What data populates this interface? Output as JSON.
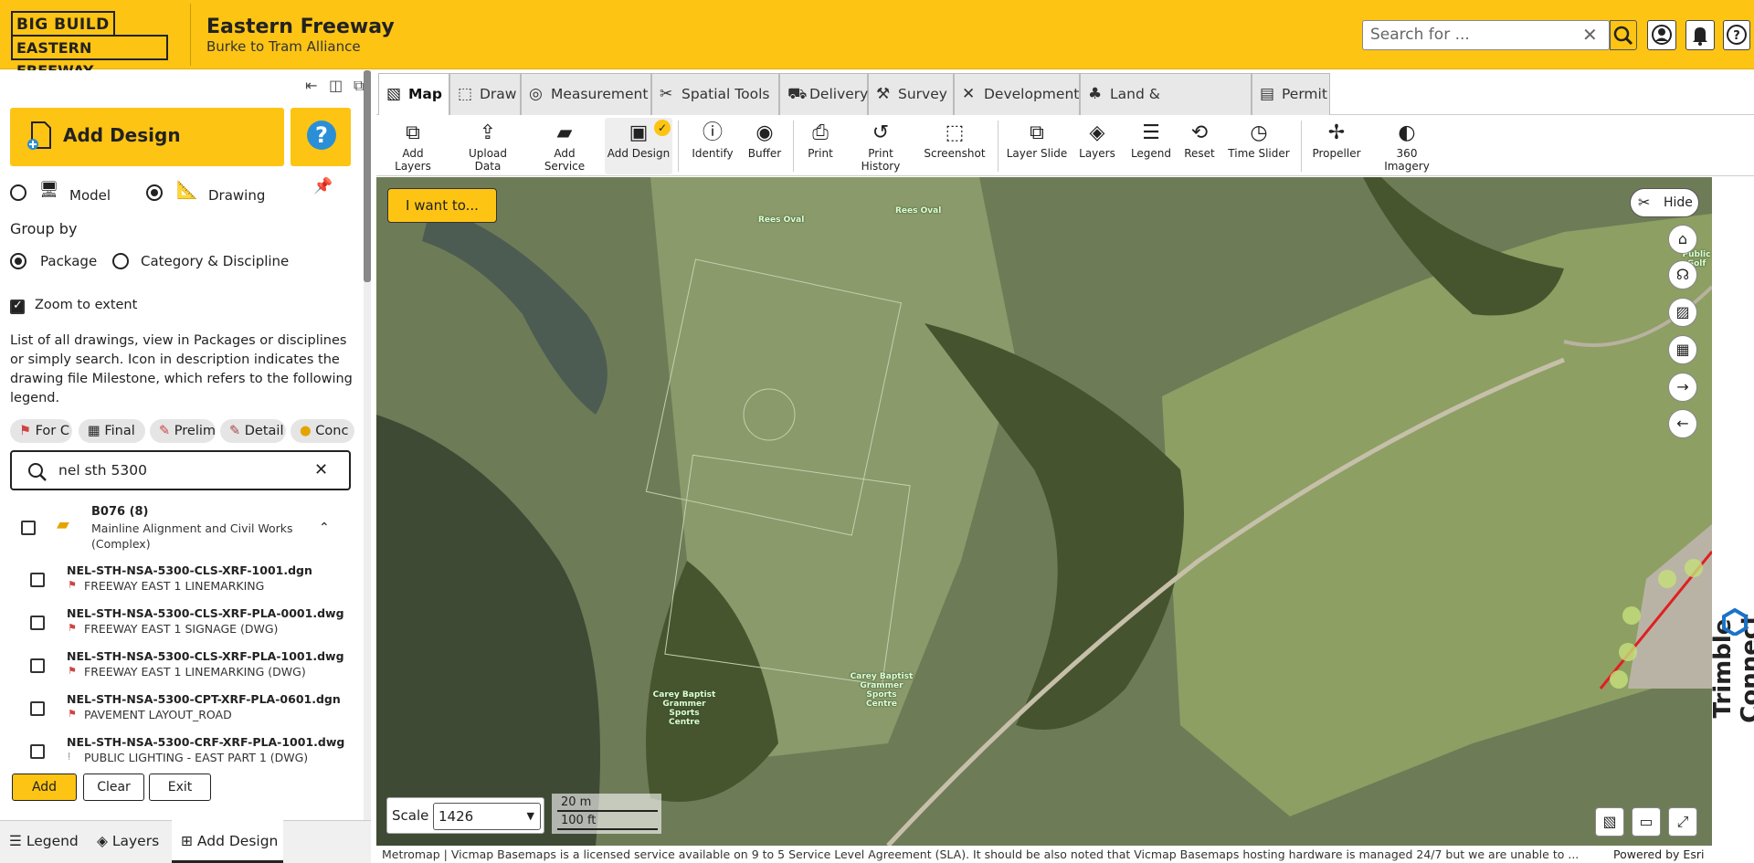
{
  "header": {
    "logo_line1": "BIG BUILD",
    "logo_line2": "EASTERN FREEWAY",
    "title": "Eastern Freeway",
    "subtitle": "Burke to Tram  Alliance",
    "search_placeholder": "Search for ...",
    "icons": [
      "search-icon",
      "user-icon",
      "bell-icon",
      "help-icon"
    ]
  },
  "panel": {
    "add_design_label": "Add Design",
    "model_label": "Model",
    "drawing_label": "Drawing",
    "group_by_label": "Group by",
    "package_label": "Package",
    "category_label": "Category & Discipline",
    "zoom_label": "Zoom to extent",
    "description": "List of all drawings, view in Packages or disciplines or simply search. Icon in description indicates the drawing file Milestone, which refers to the following legend.",
    "chips": [
      "For C",
      "Final",
      "Prelim",
      "Detail",
      "Conc"
    ],
    "filter_value": "nel sth 5300",
    "group": {
      "title": "B076 (8)",
      "subtitle": "Mainline Alignment and Civil Works (Complex)"
    },
    "files": [
      {
        "name": "NEL-STH-NSA-5300-CLS-XRF-1001.dgn",
        "desc": "FREEWAY EAST 1 LINEMARKING"
      },
      {
        "name": "NEL-STH-NSA-5300-CLS-XRF-PLA-0001.dwg",
        "desc": "FREEWAY EAST 1 SIGNAGE (DWG)"
      },
      {
        "name": "NEL-STH-NSA-5300-CLS-XRF-PLA-1001.dwg",
        "desc": "FREEWAY EAST 1 LINEMARKING (DWG)"
      },
      {
        "name": "NEL-STH-NSA-5300-CPT-XRF-PLA-0601.dgn",
        "desc": "PAVEMENT LAYOUT_ROAD"
      },
      {
        "name": "NEL-STH-NSA-5300-CRF-XRF-PLA-1001.dwg",
        "desc": "PUBLIC LIGHTING - EAST PART 1 (DWG)"
      }
    ],
    "btn_add": "Add",
    "btn_clear": "Clear",
    "btn_exit": "Exit",
    "bottom_tabs": [
      "Legend",
      "Layers",
      "Add Design"
    ]
  },
  "tabs": [
    "Map",
    "Draw",
    "Measurement",
    "Spatial Tools",
    "Delivery",
    "Survey",
    "Development",
    "Land & Environment",
    "Permit"
  ],
  "tools": [
    "Add Layers",
    "Upload Data",
    "Add Service",
    "Add Design",
    "Identify",
    "Buffer",
    "Print",
    "Print History",
    "Screenshot",
    "Layer Slide",
    "Layers",
    "Legend",
    "Reset",
    "Time Slider",
    "Propeller",
    "360 Imagery"
  ],
  "map": {
    "i_want_label": "I want to...",
    "hide_label": "Hide",
    "scale_label": "Scale",
    "scale_value": "1426",
    "scalebar_metric": "20 m",
    "scalebar_imperial": "100 ft",
    "labels": [
      "Rees Oval",
      "Rees Oval",
      "Carey Baptist Grammer Sports Centre",
      "Carey Baptist Grammer Sports Centre",
      "Public Golf"
    ],
    "attribution": "Metromap | Vicmap Basemaps is a licensed service available on 9 to 5 Service Level Agreement (SLA). It should be also noted that Vicmap Basemaps hosting hardware is managed 24/7 but we are unable to ...",
    "powered_by": "Powered by Esri",
    "brand": "Trimble Connect"
  },
  "colors": {
    "accent": "#fdc414",
    "help_blue": "#2a8fd6"
  }
}
